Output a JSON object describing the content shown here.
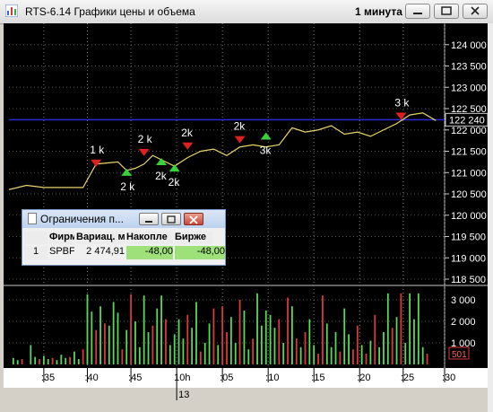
{
  "window": {
    "title": "RTS-6.14 Графики цены и объема",
    "interval": "1 минута"
  },
  "colors": {
    "background": "#000000",
    "price_line": "#e8d36a",
    "level_line": "#2b2bd6",
    "volume_up": "#5ad65a",
    "volume_down": "#d83a3a",
    "marker_buy": "#39d139",
    "marker_sell": "#e02020",
    "marker_text": "#ffffff"
  },
  "chart_data": [
    {
      "type": "line",
      "name": "price",
      "ylim": [
        118500,
        124500
      ],
      "y_ticks": [
        "118 500",
        "119 000",
        "119 500",
        "120 000",
        "120 500",
        "121 000",
        "121 500",
        "122 000",
        "122 500",
        "123 000",
        "123 500",
        "124 000"
      ],
      "x_ticks": [
        ":35",
        ":40",
        ":45",
        "10h",
        ":05",
        ":10",
        ":15",
        ":20",
        ":25",
        ":30"
      ],
      "x_secondary": "13",
      "current_price_label": "122 240",
      "current_level": 122240,
      "series": [
        {
          "x": [
            0,
            4,
            8,
            12,
            17,
            20,
            25,
            27,
            29,
            31,
            33,
            35,
            38,
            41,
            44,
            47,
            50,
            53,
            56,
            59,
            62,
            65,
            68,
            71,
            74,
            77,
            80,
            83,
            86,
            89,
            92,
            95,
            98
          ],
          "values": [
            120600,
            120700,
            120650,
            120650,
            120650,
            121200,
            121250,
            121050,
            121100,
            121200,
            121400,
            121300,
            121150,
            121350,
            121500,
            121550,
            121400,
            121600,
            121650,
            121600,
            121650,
            122050,
            121950,
            122000,
            122100,
            121900,
            121950,
            121850,
            122000,
            122150,
            122350,
            122400,
            122220
          ]
        }
      ],
      "markers": [
        {
          "x": 20,
          "y": 121200,
          "kind": "sell",
          "label": "1 k"
        },
        {
          "x": 27,
          "y": 121050,
          "kind": "buy",
          "label": "2 k"
        },
        {
          "x": 31,
          "y": 121450,
          "kind": "sell",
          "label": "2 k"
        },
        {
          "x": 35,
          "y": 121300,
          "kind": "buy",
          "label": "2k"
        },
        {
          "x": 38,
          "y": 121150,
          "kind": "buy",
          "label": "2k"
        },
        {
          "x": 41,
          "y": 121600,
          "kind": "sell",
          "label": "2k"
        },
        {
          "x": 53,
          "y": 121750,
          "kind": "sell",
          "label": "2k"
        },
        {
          "x": 59,
          "y": 121900,
          "kind": "buy",
          "label": "3k"
        },
        {
          "x": 90,
          "y": 122300,
          "kind": "sell",
          "label": "3 k"
        }
      ]
    },
    {
      "type": "bar",
      "name": "volume",
      "ylim": [
        0,
        3500
      ],
      "y_ticks": [
        "1 000",
        "2 000",
        "3 000"
      ],
      "current_volume_label": "501",
      "current_volume": 501,
      "bars": [
        {
          "x": 1,
          "v": 300,
          "d": "up"
        },
        {
          "x": 2,
          "v": 200,
          "d": "up"
        },
        {
          "x": 3,
          "v": 250,
          "d": "down"
        },
        {
          "x": 5,
          "v": 900,
          "d": "up"
        },
        {
          "x": 6,
          "v": 350,
          "d": "up"
        },
        {
          "x": 7,
          "v": 250,
          "d": "down"
        },
        {
          "x": 8,
          "v": 400,
          "d": "up"
        },
        {
          "x": 9,
          "v": 250,
          "d": "up"
        },
        {
          "x": 10,
          "v": 300,
          "d": "down"
        },
        {
          "x": 11,
          "v": 200,
          "d": "up"
        },
        {
          "x": 12,
          "v": 450,
          "d": "up"
        },
        {
          "x": 13,
          "v": 300,
          "d": "up"
        },
        {
          "x": 14,
          "v": 350,
          "d": "down"
        },
        {
          "x": 15,
          "v": 600,
          "d": "up"
        },
        {
          "x": 16,
          "v": 250,
          "d": "up"
        },
        {
          "x": 17,
          "v": 700,
          "d": "down"
        },
        {
          "x": 18,
          "v": 3250,
          "d": "up"
        },
        {
          "x": 19,
          "v": 2450,
          "d": "up"
        },
        {
          "x": 20,
          "v": 1600,
          "d": "down"
        },
        {
          "x": 21,
          "v": 2700,
          "d": "up"
        },
        {
          "x": 22,
          "v": 1900,
          "d": "down"
        },
        {
          "x": 23,
          "v": 1800,
          "d": "up"
        },
        {
          "x": 24,
          "v": 2900,
          "d": "up"
        },
        {
          "x": 25,
          "v": 2400,
          "d": "up"
        },
        {
          "x": 26,
          "v": 700,
          "d": "down"
        },
        {
          "x": 27,
          "v": 1600,
          "d": "up"
        },
        {
          "x": 28,
          "v": 3250,
          "d": "down"
        },
        {
          "x": 29,
          "v": 2000,
          "d": "up"
        },
        {
          "x": 30,
          "v": 800,
          "d": "up"
        },
        {
          "x": 31,
          "v": 3200,
          "d": "up"
        },
        {
          "x": 32,
          "v": 1500,
          "d": "up"
        },
        {
          "x": 33,
          "v": 1800,
          "d": "down"
        },
        {
          "x": 34,
          "v": 2600,
          "d": "up"
        },
        {
          "x": 35,
          "v": 3200,
          "d": "up"
        },
        {
          "x": 36,
          "v": 2100,
          "d": "down"
        },
        {
          "x": 37,
          "v": 900,
          "d": "up"
        },
        {
          "x": 38,
          "v": 1400,
          "d": "up"
        },
        {
          "x": 39,
          "v": 2100,
          "d": "up"
        },
        {
          "x": 40,
          "v": 1200,
          "d": "up"
        },
        {
          "x": 41,
          "v": 2300,
          "d": "down"
        },
        {
          "x": 42,
          "v": 1700,
          "d": "up"
        },
        {
          "x": 43,
          "v": 2900,
          "d": "up"
        },
        {
          "x": 44,
          "v": 600,
          "d": "down"
        },
        {
          "x": 45,
          "v": 1000,
          "d": "up"
        },
        {
          "x": 46,
          "v": 1900,
          "d": "up"
        },
        {
          "x": 47,
          "v": 2600,
          "d": "down"
        },
        {
          "x": 48,
          "v": 900,
          "d": "up"
        },
        {
          "x": 49,
          "v": 2700,
          "d": "down"
        },
        {
          "x": 50,
          "v": 1500,
          "d": "down"
        },
        {
          "x": 51,
          "v": 2200,
          "d": "up"
        },
        {
          "x": 52,
          "v": 1000,
          "d": "up"
        },
        {
          "x": 53,
          "v": 3000,
          "d": "down"
        },
        {
          "x": 54,
          "v": 2500,
          "d": "up"
        },
        {
          "x": 55,
          "v": 700,
          "d": "up"
        },
        {
          "x": 56,
          "v": 1200,
          "d": "down"
        },
        {
          "x": 57,
          "v": 3300,
          "d": "up"
        },
        {
          "x": 58,
          "v": 1800,
          "d": "up"
        },
        {
          "x": 59,
          "v": 2500,
          "d": "up"
        },
        {
          "x": 60,
          "v": 2300,
          "d": "up"
        },
        {
          "x": 61,
          "v": 1700,
          "d": "up"
        },
        {
          "x": 62,
          "v": 2100,
          "d": "down"
        },
        {
          "x": 63,
          "v": 1000,
          "d": "up"
        },
        {
          "x": 64,
          "v": 3100,
          "d": "down"
        },
        {
          "x": 65,
          "v": 2700,
          "d": "up"
        },
        {
          "x": 66,
          "v": 1200,
          "d": "down"
        },
        {
          "x": 67,
          "v": 800,
          "d": "up"
        },
        {
          "x": 68,
          "v": 1500,
          "d": "down"
        },
        {
          "x": 69,
          "v": 2100,
          "d": "up"
        },
        {
          "x": 70,
          "v": 900,
          "d": "up"
        },
        {
          "x": 71,
          "v": 500,
          "d": "down"
        },
        {
          "x": 72,
          "v": 3200,
          "d": "down"
        },
        {
          "x": 73,
          "v": 1900,
          "d": "up"
        },
        {
          "x": 74,
          "v": 800,
          "d": "up"
        },
        {
          "x": 75,
          "v": 1500,
          "d": "up"
        },
        {
          "x": 76,
          "v": 600,
          "d": "down"
        },
        {
          "x": 77,
          "v": 2600,
          "d": "up"
        },
        {
          "x": 78,
          "v": 1400,
          "d": "up"
        },
        {
          "x": 79,
          "v": 700,
          "d": "down"
        },
        {
          "x": 80,
          "v": 1800,
          "d": "down"
        },
        {
          "x": 81,
          "v": 900,
          "d": "up"
        },
        {
          "x": 82,
          "v": 500,
          "d": "down"
        },
        {
          "x": 83,
          "v": 1100,
          "d": "up"
        },
        {
          "x": 84,
          "v": 2300,
          "d": "down"
        },
        {
          "x": 85,
          "v": 800,
          "d": "up"
        },
        {
          "x": 86,
          "v": 1500,
          "d": "up"
        },
        {
          "x": 87,
          "v": 3300,
          "d": "up"
        },
        {
          "x": 88,
          "v": 1700,
          "d": "down"
        },
        {
          "x": 89,
          "v": 2200,
          "d": "up"
        },
        {
          "x": 90,
          "v": 3300,
          "d": "down"
        },
        {
          "x": 91,
          "v": 1000,
          "d": "up"
        },
        {
          "x": 92,
          "v": 3300,
          "d": "up"
        },
        {
          "x": 93,
          "v": 2100,
          "d": "up"
        },
        {
          "x": 94,
          "v": 3300,
          "d": "up"
        },
        {
          "x": 95,
          "v": 800,
          "d": "up"
        },
        {
          "x": 96,
          "v": 500,
          "d": "down"
        }
      ]
    }
  ],
  "mini_window": {
    "title": "Ограничения п...",
    "columns": [
      "Фирм",
      "Вариац. м",
      "Накопле",
      "Бирже"
    ],
    "row_number": "1",
    "cells": [
      "SPBFL",
      "2 474,91",
      "-48,00",
      "-48,00"
    ]
  }
}
